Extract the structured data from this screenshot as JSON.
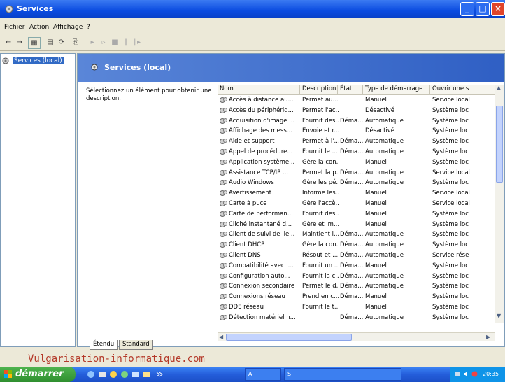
{
  "window": {
    "title": "Services"
  },
  "menu": {
    "items": [
      "Fichier",
      "Action",
      "Affichage",
      "?"
    ]
  },
  "tree": {
    "root_label": "Services (local)"
  },
  "pane": {
    "title": "Services (local)",
    "description": "Sélectionnez un élément pour obtenir une description."
  },
  "table": {
    "columns": [
      "Nom",
      "Description",
      "État",
      "Type de démarrage",
      "Ouvrir une s"
    ],
    "rows": [
      [
        "Accès à distance au...",
        "Permet au...",
        "",
        "Manuel",
        "Service local"
      ],
      [
        "Accès du périphériq...",
        "Permet l'ac...",
        "",
        "Désactivé",
        "Système loc"
      ],
      [
        "Acquisition d'image ...",
        "Fournit des...",
        "Déma...",
        "Automatique",
        "Système loc"
      ],
      [
        "Affichage des mess...",
        "Envoie et r...",
        "",
        "Désactivé",
        "Système loc"
      ],
      [
        "Aide et support",
        "Permet à l'...",
        "Déma...",
        "Automatique",
        "Système loc"
      ],
      [
        "Appel de procédure...",
        "Fournit le ...",
        "Déma...",
        "Automatique",
        "Système loc"
      ],
      [
        "Application système...",
        "Gère la con...",
        "",
        "Manuel",
        "Système loc"
      ],
      [
        "Assistance TCP/IP ...",
        "Permet la p...",
        "Déma...",
        "Automatique",
        "Service local"
      ],
      [
        "Audio Windows",
        "Gère les pé...",
        "Déma...",
        "Automatique",
        "Système loc"
      ],
      [
        "Avertissement",
        "Informe les...",
        "",
        "Manuel",
        "Service local"
      ],
      [
        "Carte à puce",
        "Gère l'accè...",
        "",
        "Manuel",
        "Service local"
      ],
      [
        "Carte de performan...",
        "Fournit des...",
        "",
        "Manuel",
        "Système loc"
      ],
      [
        "Cliché instantané d...",
        "Gère et im...",
        "",
        "Manuel",
        "Système loc"
      ],
      [
        "Client de suivi de lie...",
        "Maintient l...",
        "Déma...",
        "Automatique",
        "Système loc"
      ],
      [
        "Client DHCP",
        "Gère la con...",
        "Déma...",
        "Automatique",
        "Système loc"
      ],
      [
        "Client DNS",
        "Résout et ...",
        "Déma...",
        "Automatique",
        "Service rése"
      ],
      [
        "Compatibilité avec l...",
        "Fournit un ...",
        "Déma...",
        "Manuel",
        "Système loc"
      ],
      [
        "Configuration auto...",
        "Fournit la c...",
        "Déma...",
        "Automatique",
        "Système loc"
      ],
      [
        "Connexion secondaire",
        "Permet le d...",
        "Déma...",
        "Automatique",
        "Système loc"
      ],
      [
        "Connexions réseau",
        "Prend en c...",
        "Déma...",
        "Manuel",
        "Système loc"
      ],
      [
        "DDE réseau",
        "Fournit le t...",
        "",
        "Manuel",
        "Système loc"
      ],
      [
        "Détection matériel n...",
        "",
        "Déma...",
        "Automatique",
        "Système loc"
      ]
    ]
  },
  "tabs": [
    "Étendu",
    "Standard"
  ],
  "watermark": "Vulgarisation-informatique.com",
  "taskbar": {
    "start_label": "démarrer",
    "tasks": [
      "A",
      "S"
    ],
    "clock": "20:35"
  },
  "colors": {
    "titlebar": "#0a4be0",
    "start": "#3a9a3a",
    "selection": "#316ac5"
  }
}
